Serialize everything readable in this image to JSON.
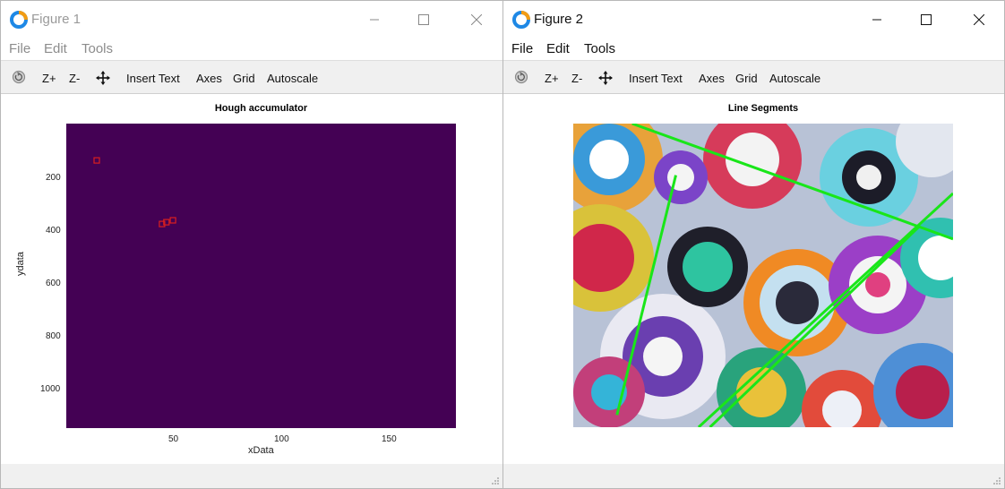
{
  "figure1": {
    "title": "Figure 1",
    "menu": [
      "File",
      "Edit",
      "Tools"
    ],
    "toolbar": {
      "zoom_in": "Z+",
      "zoom_out": "Z-",
      "insert_text": "Insert Text",
      "axes": "Axes",
      "grid": "Grid",
      "autoscale": "Autoscale"
    },
    "plot_title": "Hough accumulator",
    "xlabel": "xData",
    "ylabel": "ydata",
    "xticks": [
      "50",
      "100",
      "150"
    ],
    "yticks": [
      "200",
      "400",
      "600",
      "800",
      "1000"
    ]
  },
  "figure2": {
    "title": "Figure 2",
    "menu": [
      "File",
      "Edit",
      "Tools"
    ],
    "toolbar": {
      "zoom_in": "Z+",
      "zoom_out": "Z-",
      "insert_text": "Insert Text",
      "axes": "Axes",
      "grid": "Grid",
      "autoscale": "Autoscale"
    },
    "plot_title": "Line Segments"
  },
  "chart_data": [
    {
      "type": "heatmap",
      "title": "Hough accumulator",
      "xlabel": "xData",
      "ylabel": "ydata",
      "xlim": [
        1,
        180
      ],
      "ylim": [
        1150,
        1
      ],
      "y_reversed": true,
      "colormap": "viridis",
      "peaks": [
        {
          "x": 15,
          "y": 140
        },
        {
          "x": 45,
          "y": 380
        },
        {
          "x": 47,
          "y": 373
        },
        {
          "x": 50,
          "y": 366
        }
      ],
      "peak_marker_color": "#d91e1e"
    },
    {
      "type": "image",
      "title": "Line Segments",
      "line_color": "#19e619",
      "segments": [
        {
          "from": [
            0.155,
            0.0
          ],
          "to": [
            1.0,
            0.38
          ]
        },
        {
          "from": [
            0.27,
            0.17
          ],
          "to": [
            0.115,
            0.96
          ]
        },
        {
          "from": [
            1.0,
            0.23
          ],
          "to": [
            0.33,
            1.0
          ]
        },
        {
          "from": [
            0.91,
            0.34
          ],
          "to": [
            0.36,
            1.0
          ]
        }
      ]
    }
  ],
  "colors": {
    "background_plot": "#440154",
    "toolbar_bg": "#f0f0f0",
    "accent_icon": "#1e88e5"
  }
}
